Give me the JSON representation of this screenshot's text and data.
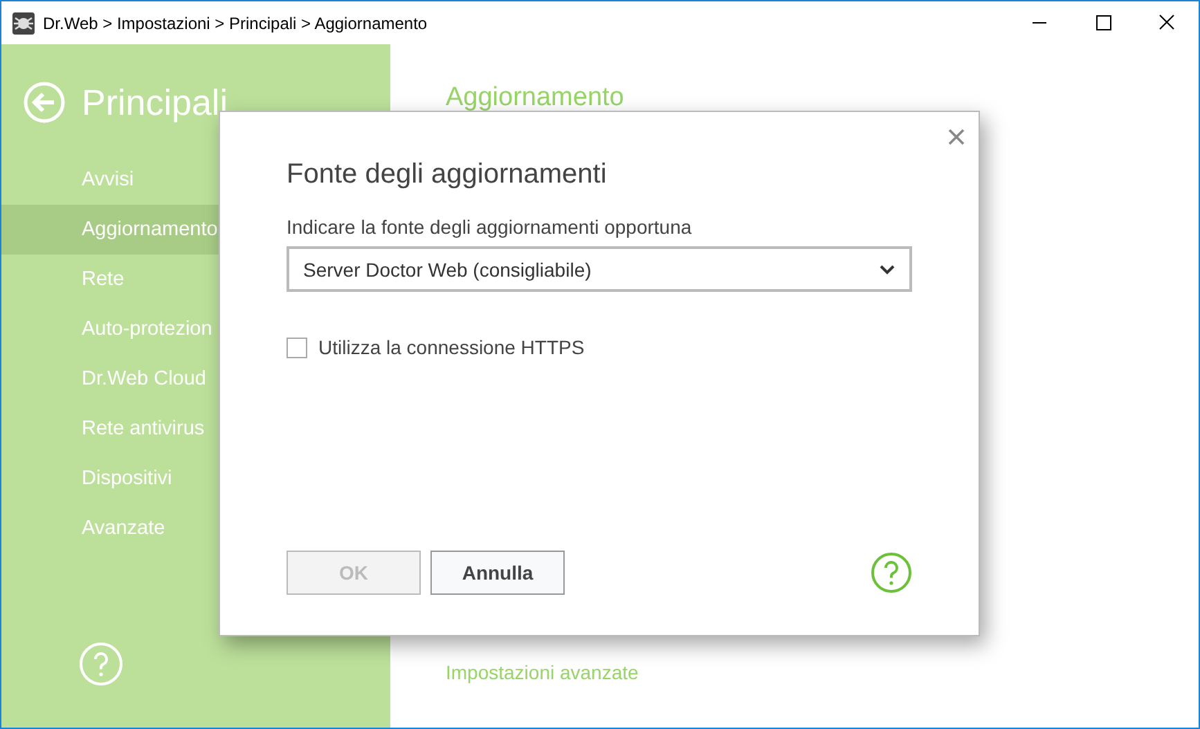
{
  "window": {
    "title": "Dr.Web > Impostazioni > Principali > Aggiornamento"
  },
  "sidebar": {
    "title": "Principali",
    "items": [
      {
        "label": "Avvisi",
        "selected": false
      },
      {
        "label": "Aggiornamento",
        "selected": true
      },
      {
        "label": "Rete",
        "selected": false
      },
      {
        "label": "Auto-protezion",
        "selected": false
      },
      {
        "label": "Dr.Web Cloud",
        "selected": false
      },
      {
        "label": "Rete antivirus",
        "selected": false
      },
      {
        "label": "Dispositivi",
        "selected": false
      },
      {
        "label": "Avanzate",
        "selected": false
      }
    ]
  },
  "content": {
    "heading": "Aggiornamento",
    "link": "Impostazioni avanzate"
  },
  "dialog": {
    "title": "Fonte degli aggiornamenti",
    "label": "Indicare la fonte degli aggiornamenti opportuna",
    "dropdown": {
      "value": "Server Doctor Web (consigliabile)"
    },
    "checkbox": {
      "label": "Utilizza la connessione HTTPS",
      "checked": false
    },
    "buttons": [
      {
        "label": "OK",
        "disabled": true
      },
      {
        "label": "Annulla",
        "disabled": false
      }
    ]
  }
}
